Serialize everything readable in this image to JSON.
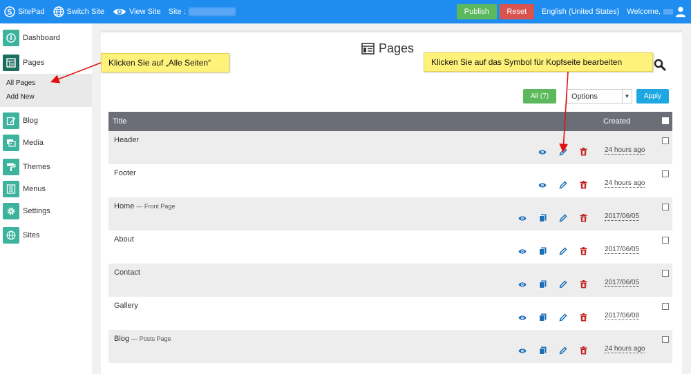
{
  "topbar": {
    "brand": "SitePad",
    "switch_site": "Switch Site",
    "view_site": "View Site",
    "site_label": "Site :",
    "publish": "Publish",
    "reset": "Reset",
    "language": "English (United States)",
    "welcome": "Welcome,"
  },
  "sidebar": {
    "items": [
      {
        "label": "Dashboard",
        "icon": "dashboard-icon"
      },
      {
        "label": "Pages",
        "icon": "pages-icon"
      },
      {
        "label": "Blog",
        "icon": "blog-icon"
      },
      {
        "label": "Media",
        "icon": "media-icon"
      },
      {
        "label": "Themes",
        "icon": "themes-icon"
      },
      {
        "label": "Menus",
        "icon": "menus-icon"
      },
      {
        "label": "Settings",
        "icon": "settings-icon"
      },
      {
        "label": "Sites",
        "icon": "sites-icon"
      }
    ],
    "sub": {
      "all_pages": "All Pages",
      "add_new": "Add New"
    }
  },
  "main": {
    "title": "Pages",
    "filter_all": "All (7)",
    "bulk_select": "Options",
    "apply": "Apply",
    "columns": {
      "title": "Title",
      "created": "Created"
    },
    "rows": [
      {
        "title": "Header",
        "subtitle": "",
        "created": "24 hours ago",
        "has_copy": false
      },
      {
        "title": "Footer",
        "subtitle": "",
        "created": "24 hours ago",
        "has_copy": false
      },
      {
        "title": "Home",
        "subtitle": "— Front Page",
        "created": "2017/06/05",
        "has_copy": true
      },
      {
        "title": "About",
        "subtitle": "",
        "created": "2017/06/05",
        "has_copy": true
      },
      {
        "title": "Contact",
        "subtitle": "",
        "created": "2017/06/05",
        "has_copy": true
      },
      {
        "title": "Gallery",
        "subtitle": "",
        "created": "2017/06/08",
        "has_copy": true
      },
      {
        "title": "Blog",
        "subtitle": "— Posts Page",
        "created": "24 hours ago",
        "has_copy": true
      }
    ]
  },
  "callouts": {
    "all_pages": "Klicken Sie auf „Alle Seiten“",
    "edit_header": "Klicken Sie auf das Symbol für Kopfseite bearbeiten"
  },
  "colors": {
    "topbar": "#1f8cf0",
    "sidebar_icon": "#3db39e",
    "publish": "#5cb85c",
    "reset": "#d9534f",
    "apply": "#1ea7e0",
    "table_header": "#6b6e77",
    "icon_blue": "#1a6fb5",
    "icon_red": "#c0201e",
    "callout": "#fff27a",
    "arrow": "#e01010"
  }
}
